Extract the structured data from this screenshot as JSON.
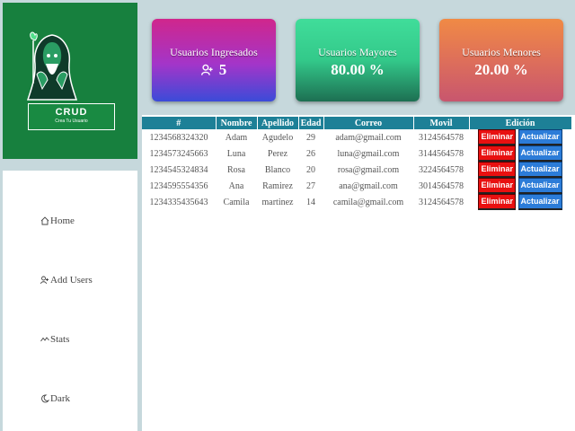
{
  "logo": {
    "brand": "CRUD",
    "tagline": "Crea Tu Usuario"
  },
  "nav": [
    {
      "label": "Home",
      "icon": "home-icon"
    },
    {
      "label": "Add Users",
      "icon": "add-user-icon"
    },
    {
      "label": "Stats",
      "icon": "stats-icon"
    },
    {
      "label": "Dark",
      "icon": "moon-icon"
    }
  ],
  "cards": {
    "ingresados": {
      "title": "Usuarios Ingresados",
      "value": "5",
      "icon": "add-user-icon"
    },
    "mayores": {
      "title": "Usuarios Mayores",
      "value": "80.00 %"
    },
    "menores": {
      "title": "Usuarios Menores",
      "value": "20.00 %"
    }
  },
  "table": {
    "headers": [
      "#",
      "Nombre",
      "Apellido",
      "Edad",
      "Correo",
      "Movil",
      "Edición"
    ],
    "delete_label": "Eliminar",
    "update_label": "Actualizar",
    "rows": [
      {
        "id": "1234568324320",
        "nombre": "Adam",
        "apellido": "Agudelo",
        "edad": "29",
        "correo": "adam@gmail.com",
        "movil": "3124564578"
      },
      {
        "id": "1234573245663",
        "nombre": "Luna",
        "apellido": "Perez",
        "edad": "26",
        "correo": "luna@gmail.com",
        "movil": "3144564578"
      },
      {
        "id": "1234545324834",
        "nombre": "Rosa",
        "apellido": "Blanco",
        "edad": "20",
        "correo": "rosa@gmail.com",
        "movil": "3224564578"
      },
      {
        "id": "1234595554356",
        "nombre": "Ana",
        "apellido": "Ramirez",
        "edad": "27",
        "correo": "ana@gmail.com",
        "movil": "3014564578"
      },
      {
        "id": "1234335435643",
        "nombre": "Camila",
        "apellido": "martinez",
        "edad": "14",
        "correo": "camila@gmail.com",
        "movil": "3124564578"
      }
    ]
  },
  "colors": {
    "sidebar_green": "#17803e",
    "table_header": "#1d8097",
    "delete": "#e81010",
    "update": "#2c7cd8"
  }
}
